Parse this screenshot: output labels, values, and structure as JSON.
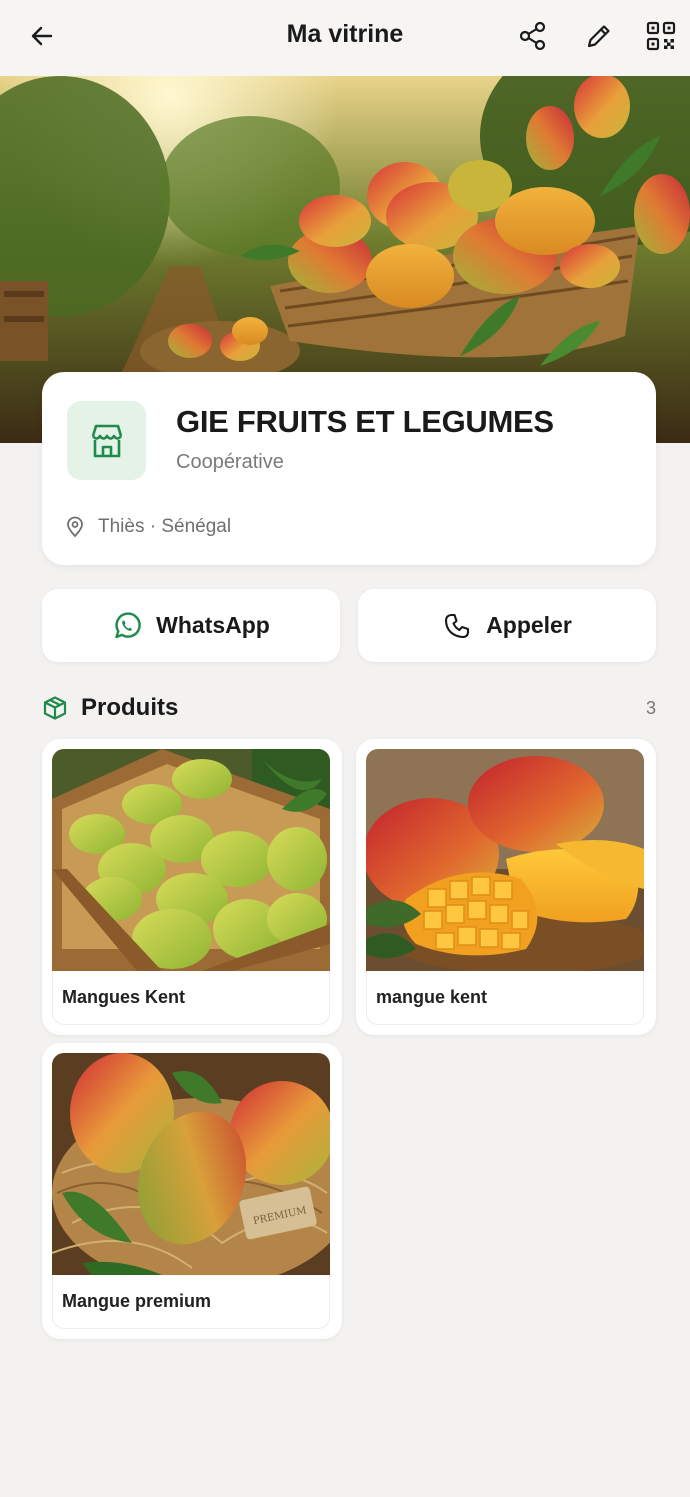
{
  "header": {
    "title": "Ma vitrine",
    "icons": [
      "back-arrow-icon",
      "share-icon",
      "edit-pencil-icon",
      "qr-code-icon"
    ]
  },
  "profile": {
    "name": "GIE FRUITS ET LEGUMES",
    "type": "Coopérative",
    "location": "Thiès · Sénégal"
  },
  "actions": {
    "whatsapp_label": "WhatsApp",
    "call_label": "Appeler"
  },
  "products": {
    "title": "Produits",
    "count": "3",
    "items": [
      {
        "name": "Mangues Kent"
      },
      {
        "name": "mangue kent"
      },
      {
        "name": "Mangue premium"
      }
    ]
  },
  "colors": {
    "accent": "#1f8a4c",
    "background": "#f3f2f0",
    "card": "#ffffff",
    "store_icon_bg": "#e4f2e8"
  }
}
